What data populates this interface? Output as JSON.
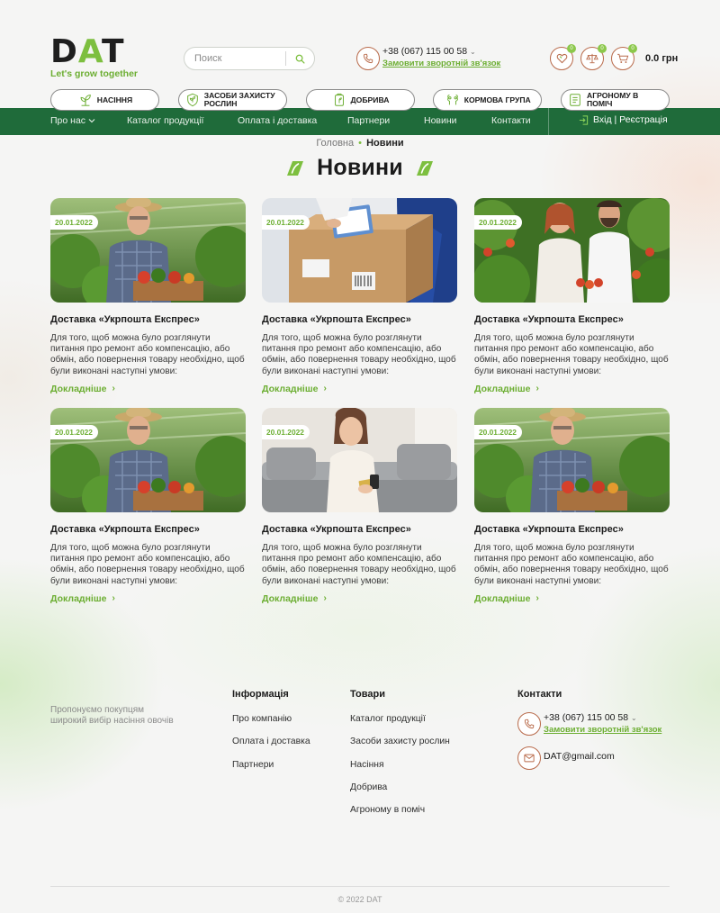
{
  "brand": {
    "logo_text_a": "D",
    "logo_text_b": "A",
    "logo_text_c": "T",
    "tagline": "Let's grow together",
    "accent": "#7dbf3f",
    "dark_green": "#1f6b3a",
    "icon_outline": "#b86a4a"
  },
  "header": {
    "search": {
      "placeholder": "Поиск"
    },
    "phone": {
      "number": "+38 (067) 115 00 58",
      "callback": "Замовити зворотній зв'язок"
    },
    "icons": {
      "favorites": {
        "icon": "heart-icon",
        "badge": "0"
      },
      "compare": {
        "icon": "scales-icon",
        "badge": "0"
      },
      "cart": {
        "icon": "cart-icon",
        "badge": "0"
      }
    },
    "cart_total": "0.0 грн"
  },
  "categories": [
    {
      "label": "Насіння",
      "icon": "seed-icon"
    },
    {
      "label": "Засоби захисту рослин",
      "icon": "plant-protection-icon"
    },
    {
      "label": "Добрива",
      "icon": "fertilizer-icon"
    },
    {
      "label": "Кормова група",
      "icon": "feed-icon"
    },
    {
      "label": "Агроному в поміч",
      "icon": "agronomist-icon"
    }
  ],
  "nav": {
    "items": [
      "Про нас",
      "Каталог продукції",
      "Оплата і доставка",
      "Партнери",
      "Новини",
      "Контакти"
    ],
    "login": "Вхід | Реєстрація"
  },
  "breadcrumb": {
    "home": "Головна",
    "current": "Новини"
  },
  "page_title": "Новини",
  "news": [
    {
      "date": "20.01.2022",
      "title": "Доставка «Укрпошта Експрес»",
      "excerpt": "Для того, щоб можна було розглянути питання про ремонт або компенсацію, або обмін, або повернення товару необхідно, щоб були виконані наступні умови:",
      "more": "Докладніше",
      "image": "farmer-vegetables"
    },
    {
      "date": "20.01.2022",
      "title": "Доставка «Укрпошта Експрес»",
      "excerpt": "Для того, щоб можна було розглянути питання про ремонт або компенсацію, або обмін, або повернення товару необхідно, щоб були виконані наступні умови:",
      "more": "Докладніше",
      "image": "parcel-delivery"
    },
    {
      "date": "20.01.2022",
      "title": "Доставка «Укрпошта Експрес»",
      "excerpt": "Для того, щоб можна було розглянути питання про ремонт або компенсацію, або обмін, або повернення товару необхідно, щоб були виконані наступні умови:",
      "more": "Докладніше",
      "image": "greenhouse-tomatoes"
    },
    {
      "date": "20.01.2022",
      "title": "Доставка «Укрпошта Експрес»",
      "excerpt": "Для того, щоб можна було розглянути питання про ремонт або компенсацію, або обмін, або повернення товару необхідно, щоб були виконані наступні умови:",
      "more": "Докладніше",
      "image": "farmer-vegetables"
    },
    {
      "date": "20.01.2022",
      "title": "Доставка «Укрпошта Експрес»",
      "excerpt": "Для того, щоб можна було розглянути питання про ремонт або компенсацію, або обмін, або повернення товару необхідно, щоб були виконані наступні умови:",
      "more": "Докладніше",
      "image": "woman-phone-card"
    },
    {
      "date": "20.01.2022",
      "title": "Доставка «Укрпошта Експрес»",
      "excerpt": "Для того, щоб можна було розглянути питання про ремонт або компенсацію, або обмін, або повернення товару необхідно, щоб були виконані наступні умови:",
      "more": "Докладніше",
      "image": "farmer-vegetables"
    }
  ],
  "footer": {
    "about": "Пропонуємо покупцям широкий вибір насіння овочів",
    "info": {
      "title": "Інформація",
      "links": [
        "Про компанію",
        "Оплата і доставка",
        "Партнери"
      ]
    },
    "goods": {
      "title": "Товари",
      "links": [
        "Каталог продукції",
        "Засоби захисту рослин",
        "Насіння",
        "Добрива",
        "Агроному в поміч"
      ]
    },
    "contacts": {
      "title": "Контакти",
      "phone": "+38 (067) 115 00 58",
      "callback": "Замовити зворотній зв'язок",
      "email": "DAT@gmail.com"
    },
    "copyright": "© 2022 DAT"
  }
}
